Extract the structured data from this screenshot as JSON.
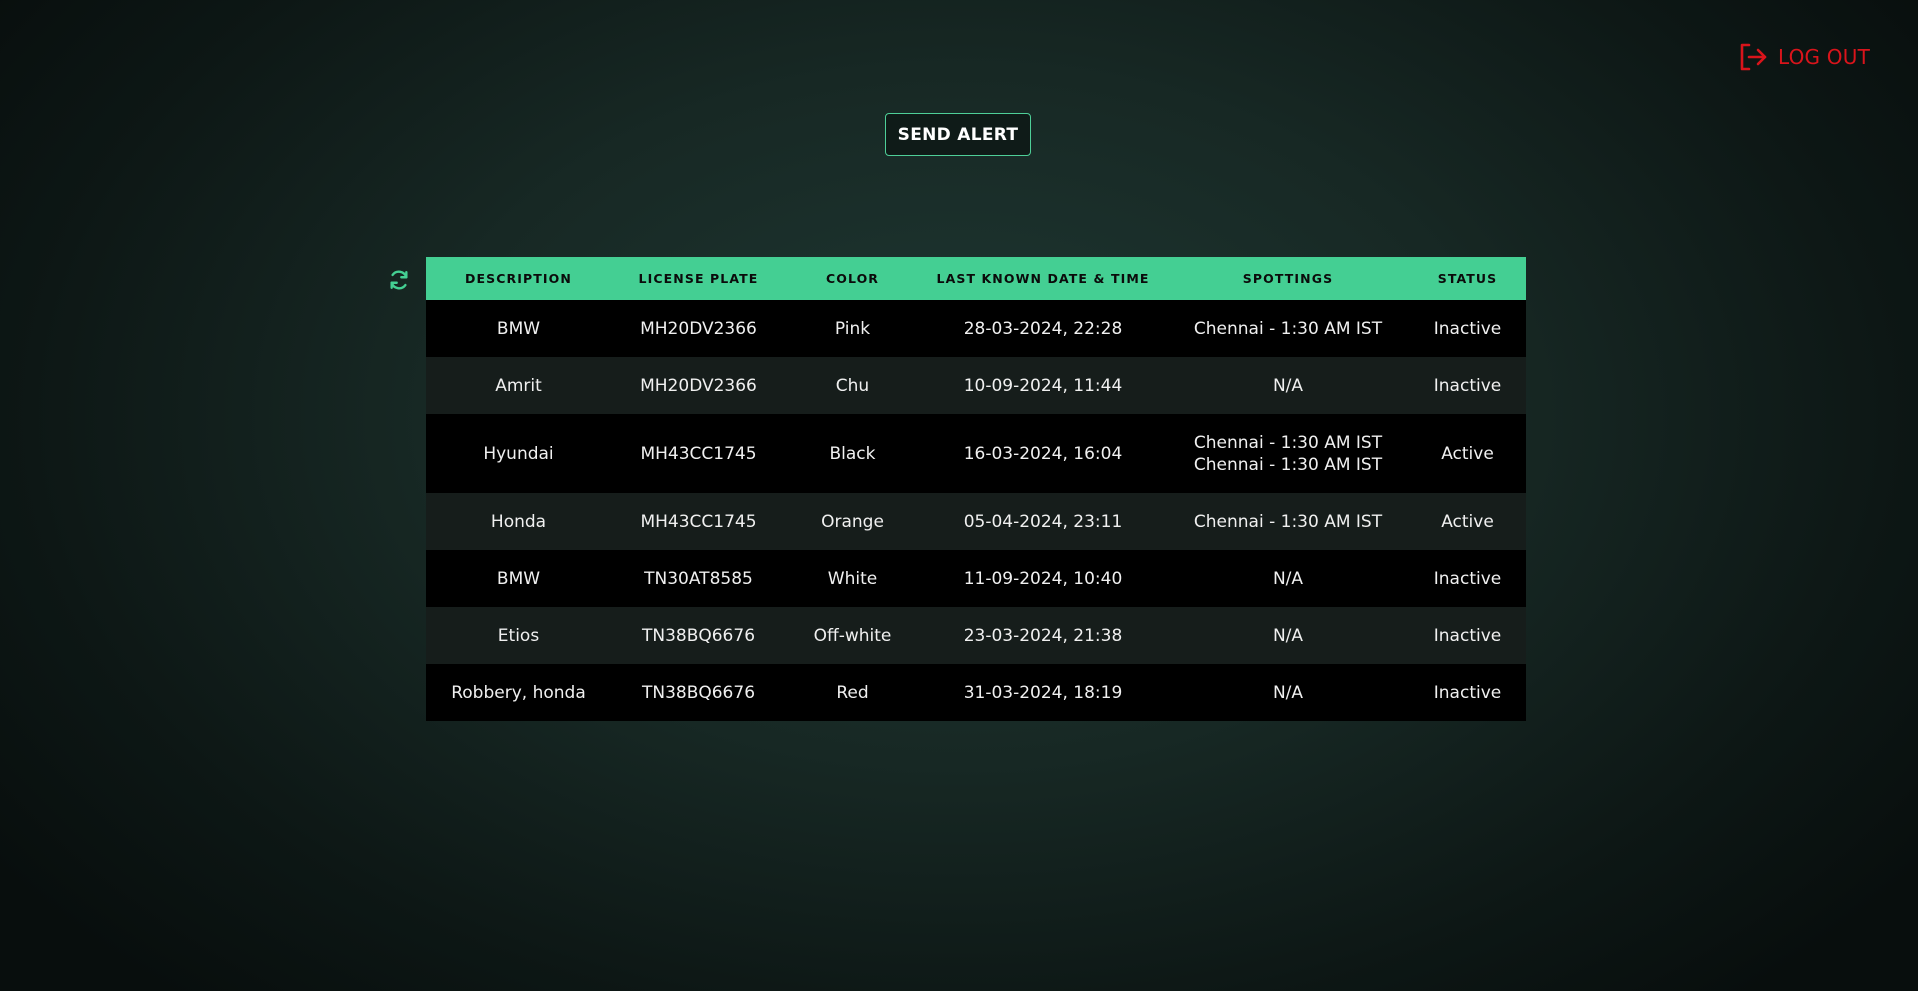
{
  "header": {
    "logout_label": "LOG OUT",
    "send_alert_label": "SEND ALERT"
  },
  "colors": {
    "accent": "#44cf93",
    "logout": "#d9141b",
    "row_dark": "#000000",
    "row_light": "#161d1b"
  },
  "icons": {
    "logout": "logout-icon",
    "refresh": "refresh-icon"
  },
  "table": {
    "headers": [
      "DESCRIPTION",
      "LICENSE PLATE",
      "COLOR",
      "LAST KNOWN DATE & TIME",
      "SPOTTINGS",
      "STATUS"
    ],
    "rows": [
      {
        "description": "BMW",
        "plate": "MH20DV2366",
        "color": "Pink",
        "datetime": "28-03-2024, 22:28",
        "spottings": [
          "Chennai - 1:30 AM IST"
        ],
        "status": "Inactive"
      },
      {
        "description": "Amrit",
        "plate": "MH20DV2366",
        "color": "Chu",
        "datetime": "10-09-2024, 11:44",
        "spottings": [
          "N/A"
        ],
        "status": "Inactive"
      },
      {
        "description": "Hyundai",
        "plate": "MH43CC1745",
        "color": "Black",
        "datetime": "16-03-2024, 16:04",
        "spottings": [
          "Chennai - 1:30 AM IST",
          "Chennai - 1:30 AM IST"
        ],
        "status": "Active"
      },
      {
        "description": "Honda",
        "plate": "MH43CC1745",
        "color": "Orange",
        "datetime": "05-04-2024, 23:11",
        "spottings": [
          "Chennai - 1:30 AM IST"
        ],
        "status": "Active"
      },
      {
        "description": "BMW",
        "plate": "TN30AT8585",
        "color": "White",
        "datetime": "11-09-2024, 10:40",
        "spottings": [
          "N/A"
        ],
        "status": "Inactive"
      },
      {
        "description": "Etios",
        "plate": "TN38BQ6676",
        "color": "Off-white",
        "datetime": "23-03-2024, 21:38",
        "spottings": [
          "N/A"
        ],
        "status": "Inactive"
      },
      {
        "description": "Robbery, honda",
        "plate": "TN38BQ6676",
        "color": "Red",
        "datetime": "31-03-2024, 18:19",
        "spottings": [
          "N/A"
        ],
        "status": "Inactive"
      }
    ]
  }
}
